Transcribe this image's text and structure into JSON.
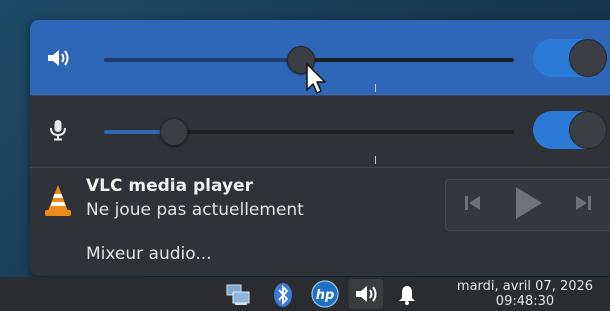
{
  "volume_popup": {
    "speaker": {
      "icon": "speaker-icon",
      "level": 0.48,
      "tick_position": 0.66,
      "enabled": true
    },
    "microphone": {
      "icon": "microphone-icon",
      "level": 0.17,
      "tick_position": 0.66,
      "enabled": true
    },
    "media_player": {
      "icon": "vlc-icon",
      "title": "VLC media player",
      "status": "Ne joue pas actuellement",
      "controls": [
        "previous-icon",
        "play-icon",
        "next-icon"
      ]
    },
    "mixer_label": "Mixeur audio..."
  },
  "taskbar": {
    "tray_icons": [
      "network-icon",
      "bluetooth-icon",
      "hp-icon",
      "volume-icon",
      "notification-bell-icon"
    ],
    "clock": {
      "date": "mardi, avril 07, 2026",
      "time": "09:48:30"
    }
  },
  "colors": {
    "accent": "#2f67b8",
    "toggle_on": "#2b7ad8",
    "panel": "#2f3236",
    "taskbar": "#2a2c2f"
  }
}
